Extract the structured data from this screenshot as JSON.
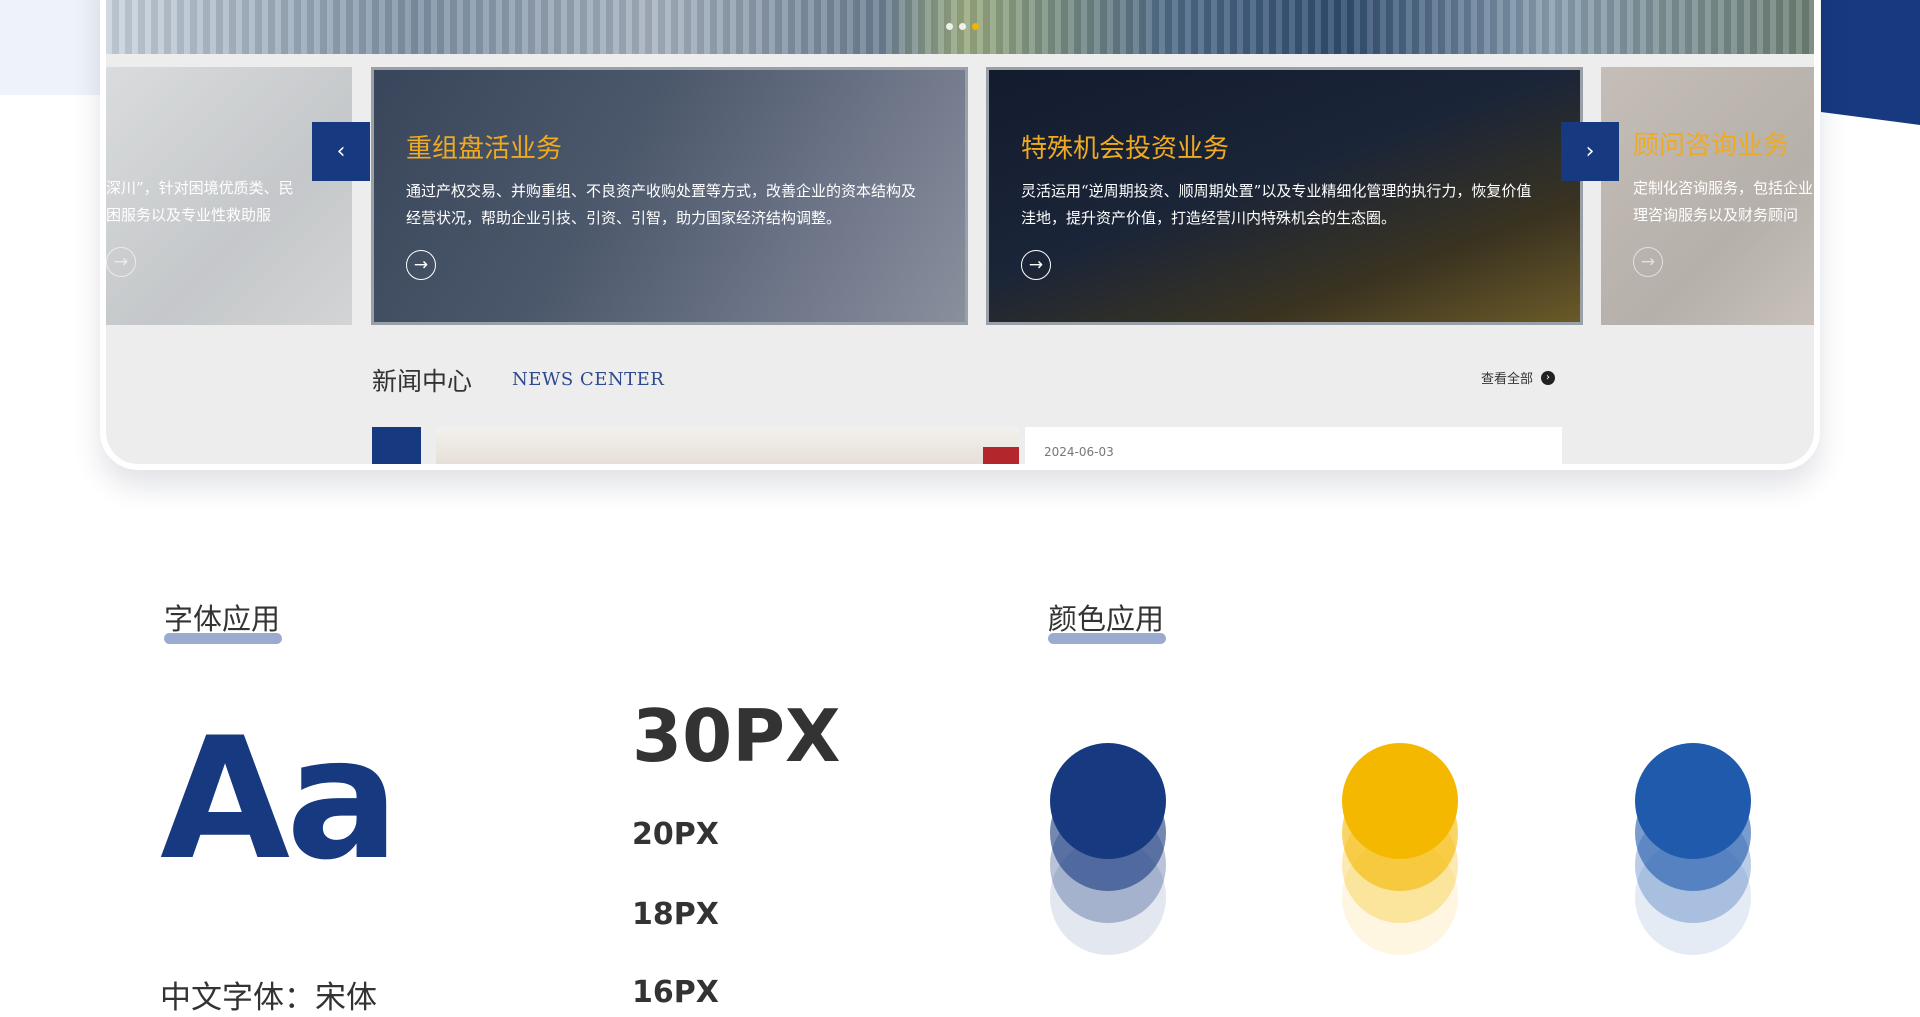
{
  "carousel": {
    "cards": [
      {
        "title": "",
        "desc": "深川”，针对困境优质类、民\n困服务以及专业性救助服"
      },
      {
        "title": "重组盘活业务",
        "desc": "通过产权交易、并购重组、不良资产收购处置等方式，改善企业的资本结构及经营状况，帮助企业引技、引资、引智，助力国家经济结构调整。"
      },
      {
        "title": "特殊机会投资业务",
        "desc": "灵活运用“逆周期投资、顺周期处置”以及专业精细化管理的执行力，恢复价值洼地，提升资产价值，打造经营川内特殊机会的生态圈。"
      },
      {
        "title": "顾问咨询业务",
        "desc": "定制化咨询服务，包括企业管理咨询服务以及财务顾问"
      }
    ],
    "prev_icon": "‹",
    "next_icon": "›",
    "arrow_icon": "→"
  },
  "news": {
    "title": "新闻中心",
    "subtitle": "NEWS CENTER",
    "view_all": "查看全部",
    "view_all_icon": "›",
    "date": "2024-06-03"
  },
  "font_section": {
    "title": "字体应用",
    "sample": "Aa",
    "sizes": [
      "30PX",
      "20PX",
      "18PX",
      "16PX"
    ],
    "chinese_font": "中文字体：宋体"
  },
  "color_section": {
    "title": "颜色应用",
    "colors": [
      "#17397f",
      "#f5b800",
      "#1f5aad"
    ]
  }
}
